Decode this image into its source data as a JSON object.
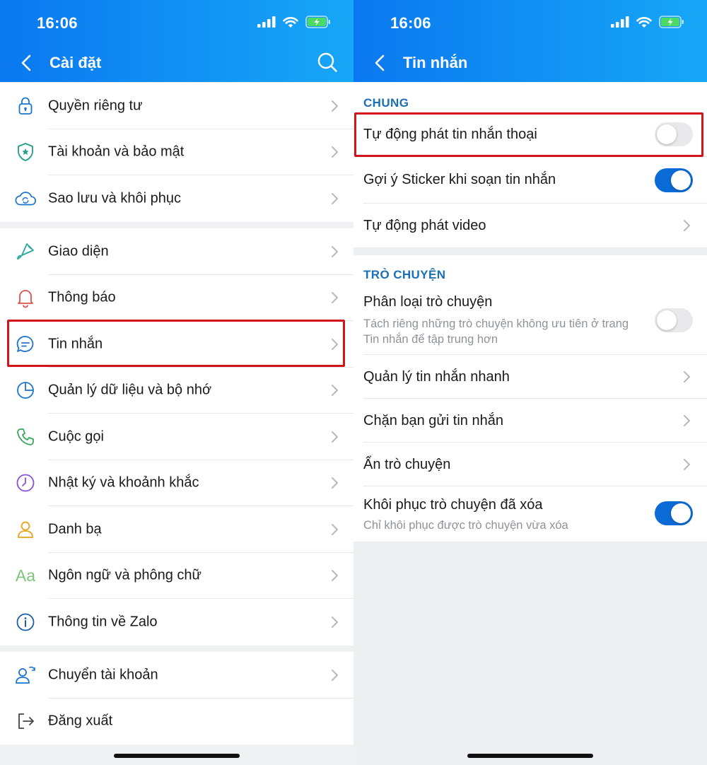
{
  "left": {
    "status": {
      "time": "16:06"
    },
    "nav": {
      "title": "Cài đặt"
    },
    "groups": [
      [
        {
          "label": "Quyền riêng tư",
          "icon": "lock-icon"
        },
        {
          "label": "Tài khoản và bảo mật",
          "icon": "shield-icon"
        },
        {
          "label": "Sao lưu và khôi phục",
          "icon": "cloud-sync-icon"
        }
      ],
      [
        {
          "label": "Giao diện",
          "icon": "paint-brush-icon"
        },
        {
          "label": "Thông báo",
          "icon": "bell-icon"
        },
        {
          "label": "Tin nhắn",
          "icon": "chat-bubble-icon"
        },
        {
          "label": "Quản lý dữ liệu và bộ nhớ",
          "icon": "pie-chart-icon"
        },
        {
          "label": "Cuộc gọi",
          "icon": "phone-icon"
        },
        {
          "label": "Nhật ký và khoảnh khắc",
          "icon": "clock-icon"
        },
        {
          "label": "Danh bạ",
          "icon": "contact-icon"
        },
        {
          "label": "Ngôn ngữ và phông chữ",
          "icon": "font-aa-icon",
          "glyph": "Aa"
        },
        {
          "label": "Thông tin về Zalo",
          "icon": "info-icon"
        }
      ],
      [
        {
          "label": "Chuyển tài khoản",
          "icon": "switch-account-icon"
        },
        {
          "label": "Đăng xuất",
          "icon": "logout-icon"
        }
      ]
    ]
  },
  "right": {
    "status": {
      "time": "16:06"
    },
    "nav": {
      "title": "Tin nhắn"
    },
    "sections": {
      "general": {
        "title": "CHUNG",
        "auto_play_voice": {
          "label": "Tự động phát tin nhắn thoại",
          "toggle": "off"
        },
        "sticker_suggest": {
          "label": "Gợi ý Sticker khi soạn tin nhắn",
          "toggle": "on"
        },
        "auto_play_video": {
          "label": "Tự động phát video"
        }
      },
      "chat": {
        "title": "TRÒ CHUYỆN",
        "classify": {
          "label": "Phân loại trò chuyện",
          "description": "Tách riêng những trò chuyện không ưu tiên ở trang Tin nhắn để tập trung hơn",
          "toggle": "off"
        },
        "quick_messages": {
          "label": "Quản lý tin nhắn nhanh"
        },
        "block_messages": {
          "label": "Chặn bạn gửi tin nhắn"
        },
        "hide_chat": {
          "label": "Ẩn trò chuyện"
        },
        "restore_deleted": {
          "label": "Khôi phục trò chuyện đã xóa",
          "description": "Chỉ khôi phục được trò chuyện vừa xóa",
          "toggle": "on"
        }
      }
    }
  },
  "colors": {
    "header_start": "#0a78f0",
    "header_end": "#17a7f7",
    "section_title": "#1b6fb5",
    "toggle_on": "#0a6ad6",
    "highlight": "#d3141b"
  }
}
